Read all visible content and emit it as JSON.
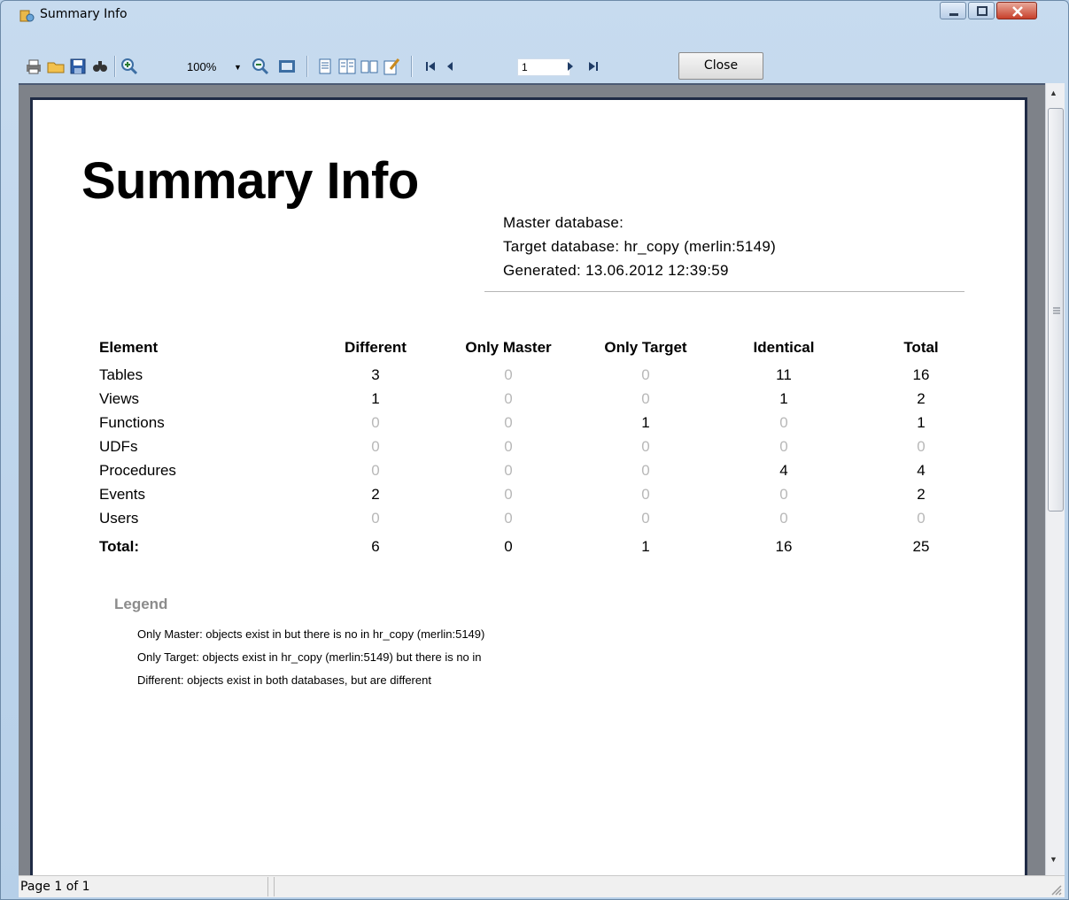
{
  "window": {
    "title": "Summary Info",
    "close_label": "Close",
    "zoom": "100%",
    "page_number": "1",
    "status": "Page 1 of 1"
  },
  "report": {
    "title": "Summary Info",
    "info": [
      "Master database:",
      "Target database: hr_copy (merlin:5149)",
      "Generated: 13.06.2012 12:39:59"
    ],
    "columns": [
      "Element",
      "Different",
      "Only Master",
      "Only Target",
      "Identical",
      "Total"
    ],
    "rows": [
      {
        "name": "Tables",
        "values": [
          "3",
          "0",
          "0",
          "11",
          "16"
        ]
      },
      {
        "name": "Views",
        "values": [
          "1",
          "0",
          "0",
          "1",
          "2"
        ]
      },
      {
        "name": "Functions",
        "values": [
          "0",
          "0",
          "1",
          "0",
          "1"
        ]
      },
      {
        "name": "UDFs",
        "values": [
          "0",
          "0",
          "0",
          "0",
          "0"
        ]
      },
      {
        "name": "Procedures",
        "values": [
          "0",
          "0",
          "0",
          "4",
          "4"
        ]
      },
      {
        "name": "Events",
        "values": [
          "2",
          "0",
          "0",
          "0",
          "2"
        ]
      },
      {
        "name": "Users",
        "values": [
          "0",
          "0",
          "0",
          "0",
          "0"
        ]
      }
    ],
    "total": {
      "name": "Total:",
      "values": [
        "6",
        "0",
        "1",
        "16",
        "25"
      ]
    },
    "legend_title": "Legend",
    "legend": [
      "Only Master: objects exist in  but there is no in hr_copy (merlin:5149)",
      "Only Target: objects exist in hr_copy (merlin:5149) but there is no in",
      "Different:  objects exist in both databases, but are different"
    ]
  },
  "colors": {
    "zero_value": "#b8b8b8",
    "legend_title": "#8c8c8c",
    "page_border": "#1f2b45",
    "viewer_bg": "#7e8289"
  }
}
